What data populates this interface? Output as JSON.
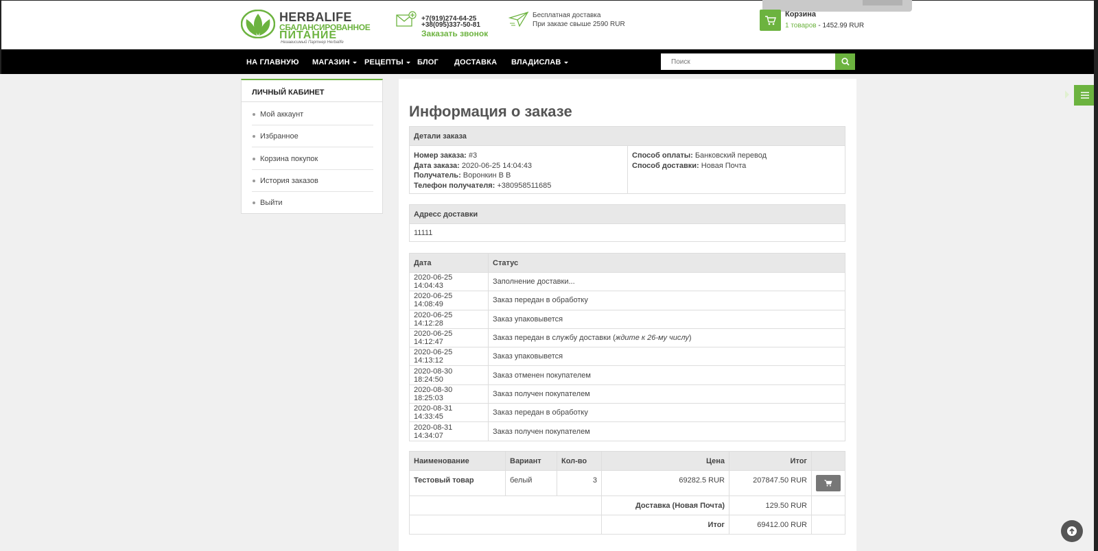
{
  "header": {
    "logo": {
      "line1": "HERBALIFE",
      "line2": "СБАЛАНСИРОВАННОЕ",
      "line3": "ПИТАНИЕ",
      "line4": "Независимый Партнер Herbalife"
    },
    "phones": [
      "+7(919)274-64-25",
      "+38(095)337-50-81"
    ],
    "callback": "Заказать звонок",
    "delivery_line1": "Бесплатная доставка",
    "delivery_line2": "При заказе свыше 2590 RUR",
    "cart": {
      "title": "Корзина",
      "count": "1 товаров",
      "total": " - 1452.99 RUR"
    }
  },
  "nav": {
    "items": [
      "НА ГЛАВНУЮ",
      "МАГАЗИН",
      "РЕЦЕПТЫ",
      "БЛОГ",
      "ДОСТАВКА",
      "ВЛАДИСЛАВ"
    ],
    "search_placeholder": "Поиск"
  },
  "sidebar": {
    "title": "ЛИЧНЫЙ КАБИНЕТ",
    "items": [
      "Мой аккаунт",
      "Избранное",
      "Корзина покупок",
      "История заказов",
      "Выйти"
    ]
  },
  "order": {
    "title": "Информация о заказе",
    "details_head": "Детали заказа",
    "number_label": "Номер заказа:",
    "number": " #3",
    "date_label": "Дата заказа:",
    "date": " 2020-06-25 14:04:43",
    "recipient_label": "Получатель:",
    "recipient": " Воронкин В В",
    "phone_label": "Телефон получателя:",
    "phone": " +380958511685",
    "payment_label": "Способ оплаты:",
    "payment": " Банковский перевод",
    "shipping_label": "Способ доставки:",
    "shipping": " Новая Почта",
    "address_head": "Адресс доставки",
    "address": "11111"
  },
  "history": {
    "col_date": "Дата",
    "col_status": "Статус",
    "rows": [
      [
        "2020-06-25 14:04:43",
        "Заполнение доставки..."
      ],
      [
        "2020-06-25 14:08:49",
        "Заказ передан в обработку"
      ],
      [
        "2020-06-25 14:12:28",
        "Заказ упаковывется"
      ],
      [
        "2020-06-25 14:12:47",
        "Заказ передан в службу доставки ("
      ],
      [
        "2020-06-25 14:13:12",
        "Заказ упаковывется"
      ],
      [
        "2020-08-30 18:24:50",
        "Заказ отменен покупателем"
      ],
      [
        "2020-08-30 18:25:03",
        "Заказ получен покупателем"
      ],
      [
        "2020-08-31 14:33:45",
        "Заказ передан в обработку"
      ],
      [
        "2020-08-31 14:34:07",
        "Заказ получен покупателем"
      ]
    ],
    "row4_italic": "ждите к 26-му числу",
    "row4_close": ")"
  },
  "products": {
    "col_name": "Наименование",
    "col_variant": "Вариант",
    "col_qty": "Кол-во",
    "col_price": "Цена",
    "col_total": "Итог",
    "row": {
      "name": "Тестовый товар",
      "variant": "белый",
      "qty": "3",
      "price": "69282.5 RUR",
      "total": "207847.50 RUR"
    },
    "delivery_label": "Доставка (Новая Почта)",
    "delivery_value": "129.50 RUR",
    "total_label": "Итог",
    "total_value": "69412.00 RUR"
  },
  "colors": {
    "accent": "#6cb33f",
    "nav_bg": "#000000",
    "header_cell": "#e8e8e8"
  }
}
